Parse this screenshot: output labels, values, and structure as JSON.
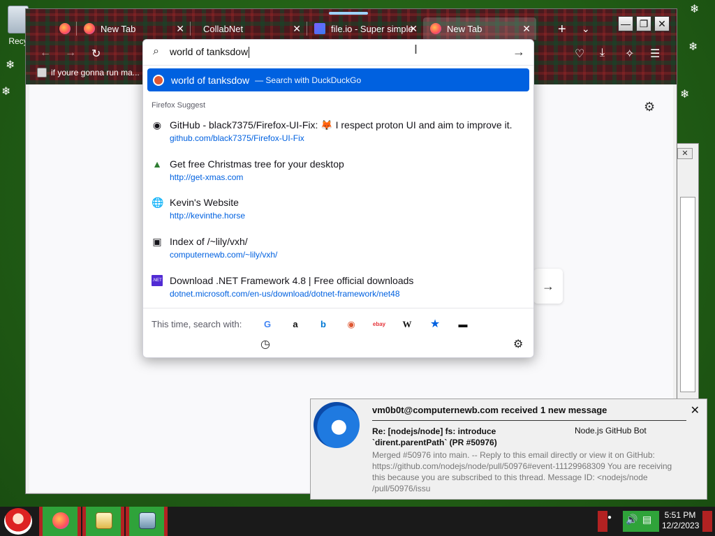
{
  "desktop": {
    "recycle_label": "Recy"
  },
  "browser": {
    "tabs": [
      {
        "label": ""
      },
      {
        "label": "New Tab"
      },
      {
        "label": "CollabNet"
      },
      {
        "label": "file.io - Super simple"
      },
      {
        "label": "New Tab"
      }
    ],
    "new_tab_symbol": "+",
    "tab_list_symbol": "⌄",
    "window_controls": {
      "minimize": "—",
      "maximize": "❐",
      "close": "✕"
    },
    "bookmark": "if youre gonna run ma..."
  },
  "urlbar": {
    "query": "world of tanksdow",
    "heuristic": {
      "query": "world of tanksdow",
      "suffix": "— Search with DuckDuckGo"
    },
    "group_label": "Firefox Suggest",
    "results": [
      {
        "icon": "github-icon",
        "title": "GitHub - black7375/Firefox-UI-Fix: 🦊 I respect proton UI and aim to improve it.",
        "url": "github.com/black7375/Firefox-UI-Fix"
      },
      {
        "icon": "christmas-tree-icon",
        "title": "Get free Christmas tree for your desktop",
        "url": "http://get-xmas.com"
      },
      {
        "icon": "globe-bookmark-icon",
        "title": "Kevin's Website",
        "url": "http://kevinthe.horse"
      },
      {
        "icon": "computer-bookmark-icon",
        "title": "Index of /~lily/vxh/",
        "url": "computernewb.com/~lily/vxh/"
      },
      {
        "icon": "dotnet-icon",
        "title": "Download .NET Framework 4.8 | Free official downloads",
        "url": "dotnet.microsoft.com/en-us/download/dotnet-framework/net48"
      }
    ],
    "oneoff_label": "This time, search with:",
    "engines": [
      {
        "name": "google-icon",
        "glyph": "G",
        "color": "#4285f4"
      },
      {
        "name": "amazon-icon",
        "glyph": "a",
        "color": "#111111"
      },
      {
        "name": "bing-icon",
        "glyph": "b",
        "color": "#0078d4"
      },
      {
        "name": "duckduckgo-icon",
        "glyph": "◉",
        "color": "#de5833"
      },
      {
        "name": "ebay-icon",
        "glyph": "ebay",
        "color": "#e53238"
      },
      {
        "name": "wikipedia-icon",
        "glyph": "W",
        "color": "#111111"
      },
      {
        "name": "bookmarks-star-icon",
        "glyph": "★",
        "color": "#0061e0"
      },
      {
        "name": "tabs-icon",
        "glyph": "▬",
        "color": "#111111"
      }
    ]
  },
  "notification": {
    "account": "vm0b0t@computernewb.com received 1 new message",
    "subject": "Re: [nodejs/node] fs: introduce `dirent.parentPath` (PR #50976)",
    "from": "Node.js GitHub Bot",
    "body": "Merged #50976 into main. -- Reply to this email directly or view it on GitHub: https://github.com/nodejs/node/pull/50976#event-11129968309 You are receiving this because you are subscribed to this thread. Message ID: <nodejs/node /pull/50976/issu",
    "close": "✕"
  },
  "taskbar": {
    "time": "5:51 PM",
    "date": "12/2/2023"
  }
}
